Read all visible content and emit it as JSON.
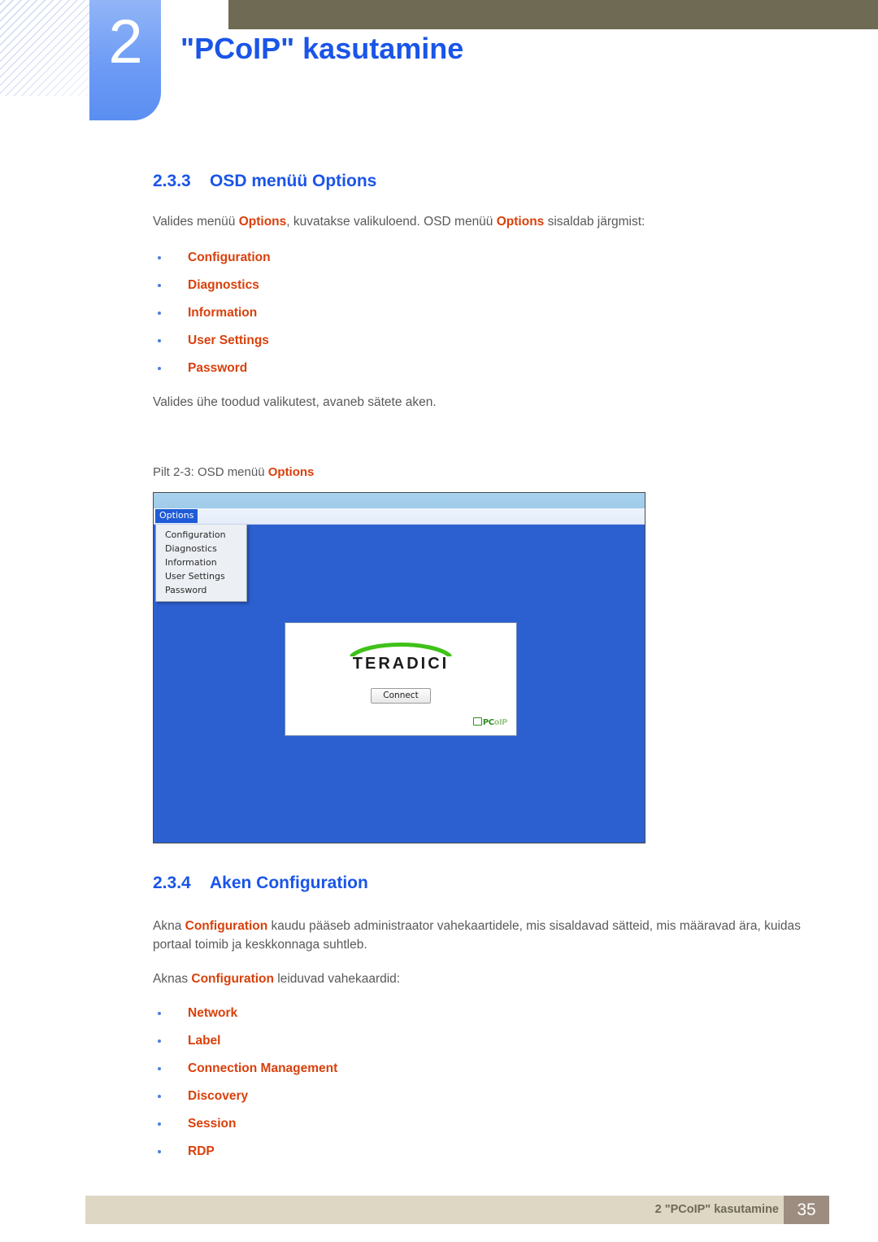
{
  "header": {
    "chapter_number": "2",
    "chapter_title": "\"PCoIP\" kasutamine"
  },
  "sections": {
    "s233": {
      "number": "2.3.3",
      "title": "OSD menüü Options",
      "intro_part1": "Valides menüü ",
      "intro_hl1": "Options",
      "intro_part2": ", kuvatakse valikuloend. OSD menüü ",
      "intro_hl2": "Options",
      "intro_part3": " sisaldab järgmist:",
      "bullets": [
        "Configuration",
        "Diagnostics",
        "Information",
        "User Settings",
        "Password"
      ],
      "after_list": "Valides ühe toodud valikutest, avaneb sätete aken.",
      "figure_caption_part1": "Pilt 2-3: OSD menüü ",
      "figure_caption_hl": "Options"
    },
    "s234": {
      "number": "2.3.4",
      "title": "Aken Configuration",
      "para1_part1": "Akna ",
      "para1_hl": "Configuration",
      "para1_part2": " kaudu pääseb administraator vahekaartidele, mis sisaldavad sätteid, mis määravad ära, kuidas portaal toimib ja keskkonnaga suhtleb.",
      "para2_part1": "Aknas ",
      "para2_hl": "Configuration",
      "para2_part2": " leiduvad vahekaardid:",
      "bullets": [
        "Network",
        "Label",
        "Connection Management",
        "Discovery",
        "Session",
        "RDP"
      ]
    }
  },
  "figure": {
    "menubar_item": "Options",
    "dropdown_items": [
      "Configuration",
      "Diagnostics",
      "Information",
      "User Settings",
      "Password"
    ],
    "logo_text": "TERADICI",
    "connect_button": "Connect",
    "watermark_pc": "PC",
    "watermark_oip": "oIP"
  },
  "footer": {
    "text": "2 \"PCoIP\" kasutamine",
    "page": "35"
  },
  "colors": {
    "heading_blue": "#1a55e8",
    "accent_orange": "#d9400b",
    "body_gray": "#58595b",
    "olive": "#6e6a53",
    "tab_blue": "#6d9bf5",
    "footer_beige": "#ddd7c4",
    "footer_page_taupe": "#9c8d80",
    "osd_blue": "#2c5fd0"
  }
}
